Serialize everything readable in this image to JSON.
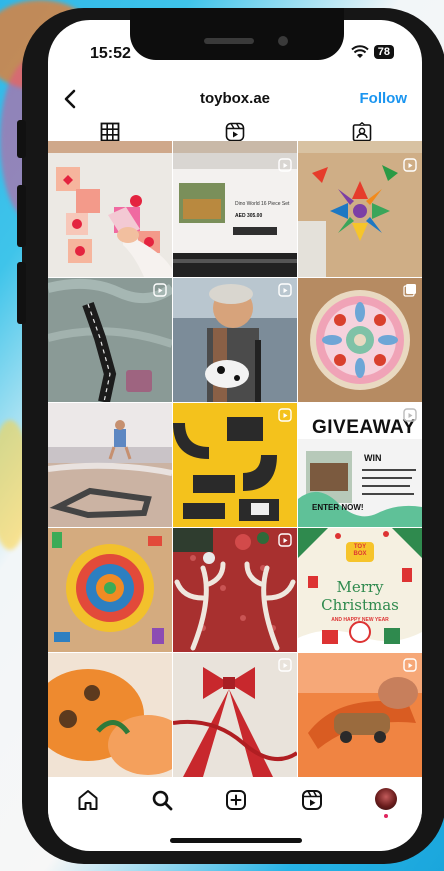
{
  "status_bar": {
    "time": "15:52",
    "battery": "78"
  },
  "header": {
    "username": "toybox.ae",
    "follow_label": "Follow"
  },
  "tabs": [
    {
      "icon": "grid-icon",
      "active": true
    },
    {
      "icon": "reels-icon",
      "active": false
    },
    {
      "icon": "tagged-icon",
      "active": false
    }
  ],
  "posts": {
    "p2": {
      "laptop_title": "Dino World 16 Piece Set",
      "laptop_price": "AED 305.00"
    },
    "p9": {
      "title": "GIVEAWAY",
      "tag": "WIN",
      "enter_label": "ENTER NOW!"
    },
    "p12": {
      "logo_line1": "TOY",
      "logo_line2": "BOX",
      "line1": "Merry",
      "line2": "Christmas",
      "subtitle": "AND HAPPY NEW YEAR"
    }
  },
  "bottom_nav": [
    "home-icon",
    "search-icon",
    "create-icon",
    "reels-icon",
    "profile-avatar"
  ],
  "colors": {
    "accent": "#1a95f0"
  }
}
